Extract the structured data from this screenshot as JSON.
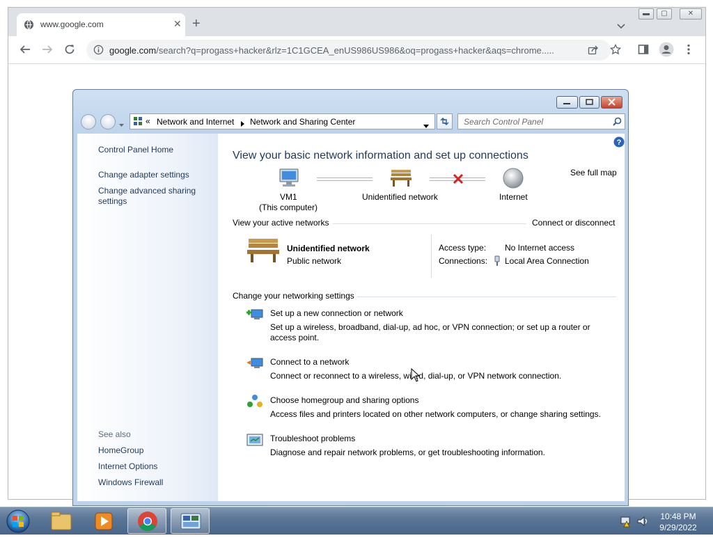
{
  "browser": {
    "tab_title": "www.google.com",
    "url_host": "google.com",
    "url_path": "/search?q=progass+hacker&rlz=1C1GCEA_enUS986US986&oq=progass+hacker&aqs=chrome....."
  },
  "control_panel": {
    "breadcrumb": {
      "chevrons": "«",
      "items": [
        "Network and Internet",
        "Network and Sharing Center"
      ]
    },
    "search_placeholder": "Search Control Panel",
    "left_pane": {
      "home": "Control Panel Home",
      "links": [
        "Change adapter settings",
        "Change advanced sharing settings"
      ],
      "see_also_label": "See also",
      "see_also": [
        "HomeGroup",
        "Internet Options",
        "Windows Firewall"
      ]
    },
    "main": {
      "title": "View your basic network information and set up connections",
      "see_full_map": "See full map",
      "map": {
        "computer_name": "VM1",
        "computer_sub": "(This computer)",
        "network_name": "Unidentified network",
        "internet": "Internet"
      },
      "active_networks_label": "View your active networks",
      "connect_or_disconnect": "Connect or disconnect",
      "active_network": {
        "name": "Unidentified network",
        "type": "Public network",
        "access_type_label": "Access type:",
        "access_type_value": "No Internet access",
        "connections_label": "Connections:",
        "connections_value": "Local Area Connection"
      },
      "change_settings_label": "Change your networking settings",
      "tasks": [
        {
          "title": "Set up a new connection or network",
          "desc": "Set up a wireless, broadband, dial-up, ad hoc, or VPN connection; or set up a router or access point."
        },
        {
          "title": "Connect to a network",
          "desc": "Connect or reconnect to a wireless, wired, dial-up, or VPN network connection."
        },
        {
          "title": "Choose homegroup and sharing options",
          "desc": "Access files and printers located on other network computers, or change sharing settings."
        },
        {
          "title": "Troubleshoot problems",
          "desc": "Diagnose and repair network problems, or get troubleshooting information."
        }
      ]
    }
  },
  "taskbar": {
    "time": "10:48 PM",
    "date": "9/29/2022"
  }
}
